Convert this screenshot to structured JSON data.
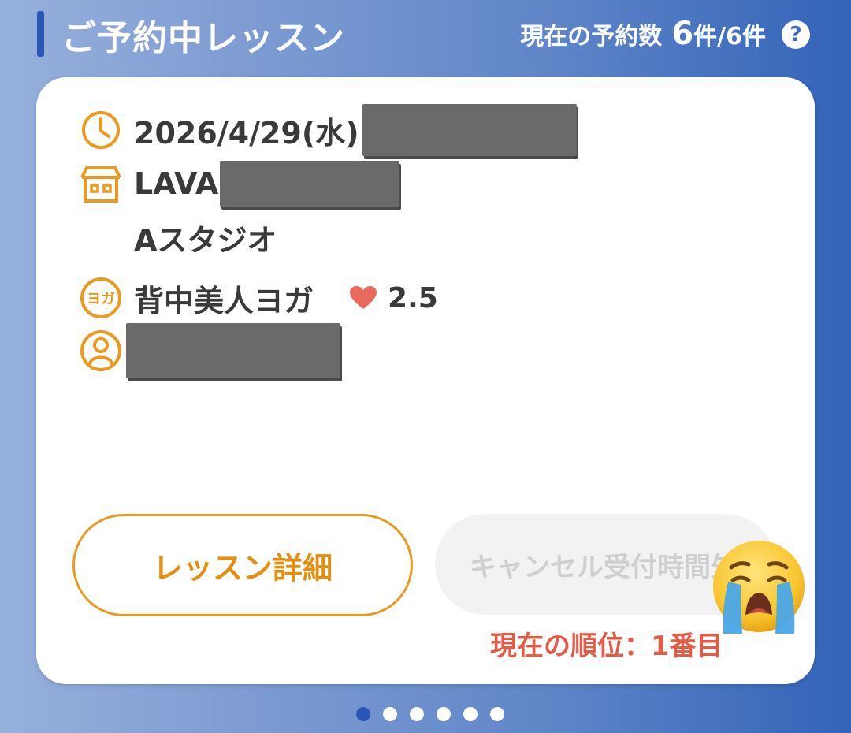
{
  "header": {
    "title": "ご予約中レッスン",
    "count_label": "現在の予約数",
    "count_current": "6",
    "count_unit": "件",
    "count_total": "/6件",
    "help_icon": "?"
  },
  "lesson": {
    "date": "2026/4/29(水)",
    "studio_prefix": "LAVA",
    "studio_room": "Aスタジオ",
    "program_icon_text": "ヨガ",
    "program": "背中美人ヨガ",
    "rating": "2.5"
  },
  "buttons": {
    "detail": "レッスン詳細",
    "cancel": "キャンセル受付時間外"
  },
  "waitlist": {
    "rank": "現在の順位：1番目"
  },
  "pager": {
    "total": 6,
    "active_index": 0
  },
  "colors": {
    "accent_orange": "#e99a1f",
    "rank_red": "#e25d48",
    "heart": "#e76a5d",
    "active_dot": "#2a57b5"
  }
}
